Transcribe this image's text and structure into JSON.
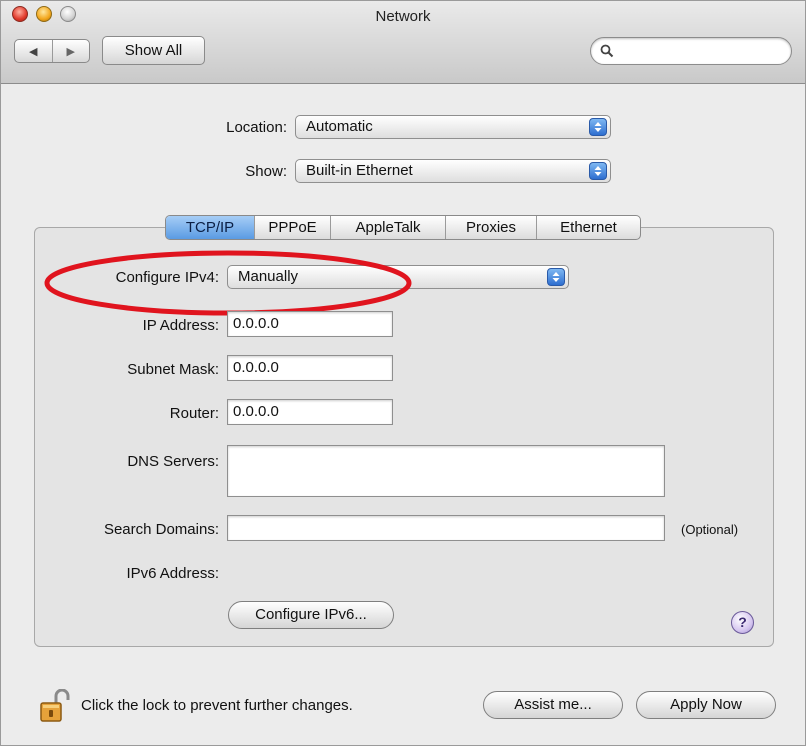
{
  "window": {
    "title": "Network"
  },
  "toolbar": {
    "back_glyph": "◀",
    "forward_glyph": "▶",
    "show_all_label": "Show All",
    "search_icon": "search-icon",
    "search_value": ""
  },
  "location": {
    "label": "Location:",
    "value": "Automatic"
  },
  "show": {
    "label": "Show:",
    "value": "Built-in Ethernet"
  },
  "tabs": [
    {
      "label": "TCP/IP",
      "active": true
    },
    {
      "label": "PPPoE",
      "active": false
    },
    {
      "label": "AppleTalk",
      "active": false
    },
    {
      "label": "Proxies",
      "active": false
    },
    {
      "label": "Ethernet",
      "active": false
    }
  ],
  "tcpip": {
    "configure_ipv4": {
      "label": "Configure IPv4:",
      "value": "Manually"
    },
    "ip_address": {
      "label": "IP Address:",
      "value": "0.0.0.0"
    },
    "subnet_mask": {
      "label": "Subnet Mask:",
      "value": "0.0.0.0"
    },
    "router": {
      "label": "Router:",
      "value": "0.0.0.0"
    },
    "dns_servers": {
      "label": "DNS Servers:",
      "value": ""
    },
    "search_domains": {
      "label": "Search Domains:",
      "value": "",
      "optional_note": "(Optional)"
    },
    "ipv6_address": {
      "label": "IPv6 Address:",
      "value": ""
    },
    "configure_ipv6_label": "Configure IPv6..."
  },
  "help_glyph": "?",
  "footer": {
    "lock_text": "Click the lock to prevent further changes.",
    "assist_label": "Assist me...",
    "apply_label": "Apply Now"
  },
  "colors": {
    "highlight_ellipse": "#e0141e",
    "active_tab": "#5a9be3",
    "popup_stepper": "#2f6fd0"
  }
}
